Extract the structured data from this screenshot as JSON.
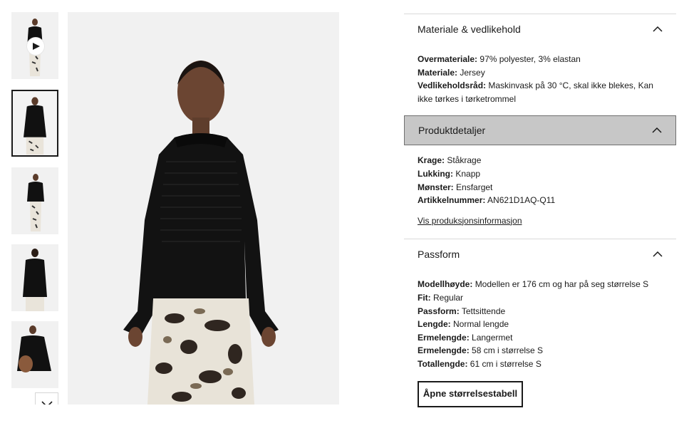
{
  "gallery": {
    "thumbnails": [
      {
        "alt": "thumbnail-1"
      },
      {
        "alt": "thumbnail-2"
      },
      {
        "alt": "thumbnail-3"
      },
      {
        "alt": "thumbnail-4"
      },
      {
        "alt": "thumbnail-5"
      }
    ],
    "selected_index": 1,
    "scroll_icon": "chevron-down-icon"
  },
  "sections": {
    "material": {
      "title": "Materiale & vedlikehold",
      "rows": [
        {
          "k": "Overmateriale:",
          "v": "97% polyester, 3% elastan"
        },
        {
          "k": "Materiale:",
          "v": "Jersey"
        },
        {
          "k": "Vedlikeholdsråd:",
          "v": "Maskinvask på 30 °C, skal ikke blekes, Kan ikke tørkes i tørketrommel"
        }
      ]
    },
    "details": {
      "title": "Produktdetaljer",
      "rows": [
        {
          "k": "Krage:",
          "v": "Ståkrage"
        },
        {
          "k": "Lukking:",
          "v": "Knapp"
        },
        {
          "k": "Mønster:",
          "v": "Ensfarget"
        },
        {
          "k": "Artikkelnummer:",
          "v": "AN621D1AQ-Q11"
        }
      ],
      "link": "Vis produksjonsinformasjon"
    },
    "fit": {
      "title": "Passform",
      "rows": [
        {
          "k": "Modellhøyde:",
          "v": "Modellen er 176 cm og har på seg størrelse S"
        },
        {
          "k": "Fit:",
          "v": "Regular"
        },
        {
          "k": "Passform:",
          "v": "Tettsittende"
        },
        {
          "k": "Lengde:",
          "v": "Normal lengde"
        },
        {
          "k": "Ermelengde:",
          "v": "Langermet"
        },
        {
          "k": "Ermelengde:",
          "v": "58 cm i størrelse S"
        },
        {
          "k": "Totallengde:",
          "v": "61 cm i størrelse S"
        }
      ],
      "button": "Åpne størrelsestabell"
    }
  },
  "colors": {
    "highlight_bg": "#c7c7c7",
    "text": "#1a1a1a",
    "divider": "#d9d9d9"
  }
}
